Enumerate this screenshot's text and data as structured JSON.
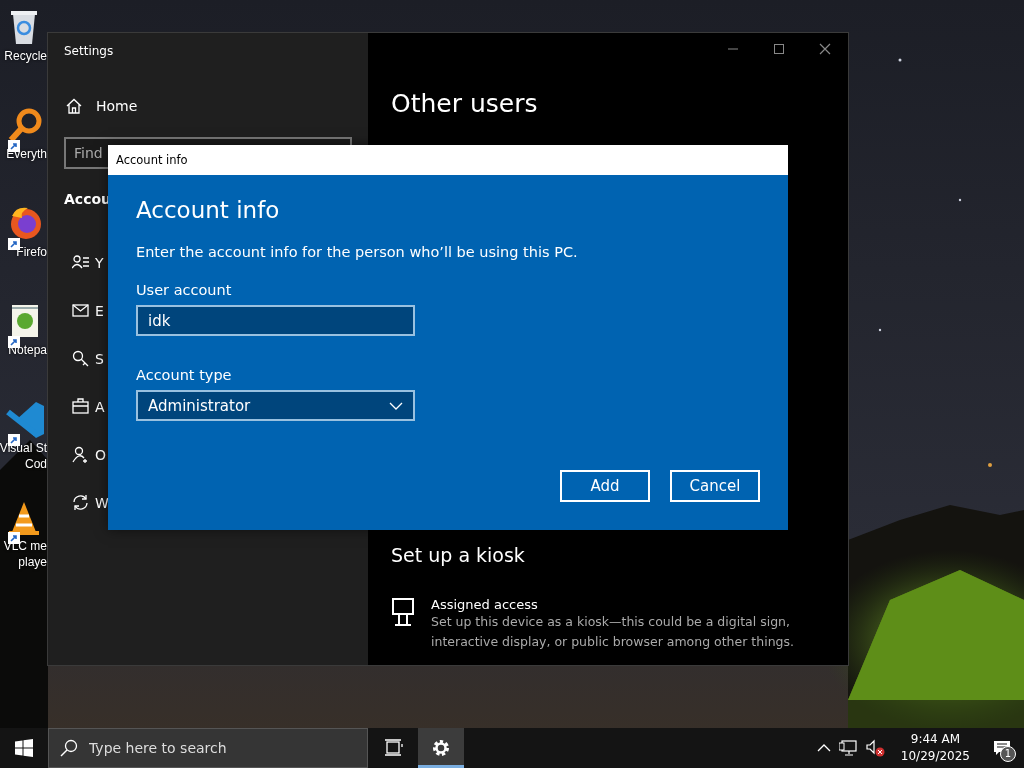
{
  "desktop_icons": [
    {
      "kind": "recycle-bin",
      "label_lines": [
        "Recycle"
      ]
    },
    {
      "kind": "magnifier",
      "label_lines": [
        "Everyth"
      ]
    },
    {
      "kind": "globe",
      "label_lines": [
        "Firefo"
      ]
    },
    {
      "kind": "notepad",
      "label_lines": [
        "Notepa"
      ]
    },
    {
      "kind": "code",
      "label_lines": [
        "Visual St",
        "Cod"
      ]
    },
    {
      "kind": "cone",
      "label_lines": [
        "VLC me",
        "playe"
      ]
    }
  ],
  "settings_window": {
    "title": "Settings",
    "home": "Home",
    "search": {
      "placeholder": "Find"
    },
    "section_heading": "Accou",
    "nav_items": [
      {
        "kind": "person-list",
        "label": "Y"
      },
      {
        "kind": "mail",
        "label": "E"
      },
      {
        "kind": "key",
        "label": "S"
      },
      {
        "kind": "briefcase",
        "label": "A"
      },
      {
        "kind": "person-add",
        "label": "O"
      },
      {
        "kind": "sync",
        "label": "W"
      }
    ],
    "page_title": "Other users",
    "kiosk": {
      "heading": "Set up a kiosk",
      "item_title": "Assigned access",
      "item_description": "Set up this device as a kiosk—this could be a digital sign, interactive display, or public browser among other things."
    }
  },
  "dialog": {
    "title": "Account info",
    "heading": "Account info",
    "instructions": "Enter the account info for the person who’ll be using this PC.",
    "fields": [
      {
        "kind": "text",
        "label": "User account",
        "value": "idk"
      },
      {
        "kind": "dropdown",
        "label": "Account type",
        "value": "Administrator"
      }
    ],
    "buttons": [
      "Add",
      "Cancel"
    ]
  },
  "taskbar": {
    "search": {
      "placeholder": "Type here to search"
    },
    "apps": [
      {
        "kind": "task-view",
        "selected": false
      },
      {
        "kind": "settings",
        "selected": true
      }
    ],
    "volume_muted": true,
    "clock": {
      "time": "9:44 AM",
      "date": "10/29/2025"
    },
    "notification_count": "1"
  }
}
